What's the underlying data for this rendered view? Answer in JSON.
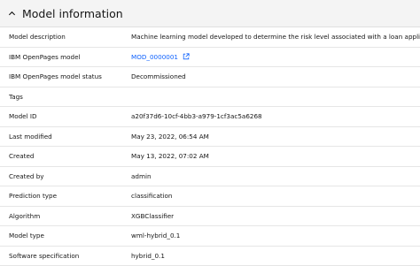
{
  "section": {
    "title": "Model information"
  },
  "rows": [
    {
      "label": "Model description",
      "value": "Machine learning model developed to determine the risk level associated with a loan application"
    },
    {
      "label": "IBM OpenPages model",
      "value": "MOD_0000001"
    },
    {
      "label": "IBM OpenPages model status",
      "value": "Decommissioned"
    },
    {
      "label": "Tags",
      "value": ""
    },
    {
      "label": "Model ID",
      "value": "a20f37d6-10cf-4bb3-a979-1cf3ac5a6268"
    },
    {
      "label": "Last modified",
      "value": "May 23, 2022, 06:54 AM"
    },
    {
      "label": "Created",
      "value": "May 13, 2022, 07:02 AM"
    },
    {
      "label": "Created by",
      "value": "admin"
    },
    {
      "label": "Prediction type",
      "value": "classification"
    },
    {
      "label": "Algorithm",
      "value": "XGBClassifier"
    },
    {
      "label": "Model type",
      "value": "wml-hybrid_0.1"
    },
    {
      "label": "Software specification",
      "value": "hybrid_0.1"
    }
  ],
  "icons": {
    "collapse": "chevron-up-icon",
    "external": "launch-icon"
  },
  "colors": {
    "link": "#0f62fe",
    "header_bg": "#f4f4f4"
  }
}
